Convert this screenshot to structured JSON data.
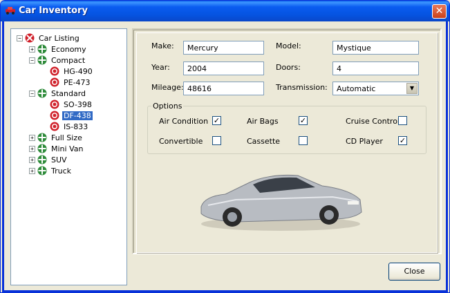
{
  "window": {
    "title": "Car Inventory",
    "close_glyph": "✕"
  },
  "tree": {
    "root": "Car Listing",
    "items": [
      {
        "label": "Economy",
        "type": "category",
        "expander": "+"
      },
      {
        "label": "Compact",
        "type": "category",
        "expander": "−"
      },
      {
        "label": "HG-490",
        "type": "car"
      },
      {
        "label": "PE-473",
        "type": "car"
      },
      {
        "label": "Standard",
        "type": "category",
        "expander": "−"
      },
      {
        "label": "SO-398",
        "type": "car"
      },
      {
        "label": "DF-438",
        "type": "car",
        "selected": true
      },
      {
        "label": "IS-833",
        "type": "car"
      },
      {
        "label": "Full Size",
        "type": "category",
        "expander": "+"
      },
      {
        "label": "Mini Van",
        "type": "category",
        "expander": "+"
      },
      {
        "label": "SUV",
        "type": "category",
        "expander": "+"
      },
      {
        "label": "Truck",
        "type": "category",
        "expander": "+"
      }
    ]
  },
  "details": {
    "make_label": "Make:",
    "make_value": "Mercury",
    "model_label": "Model:",
    "model_value": "Mystique",
    "year_label": "Year:",
    "year_value": "2004",
    "doors_label": "Doors:",
    "doors_value": "4",
    "mileage_label": "Mileage:",
    "mileage_value": "48616",
    "transmission_label": "Transmission:",
    "transmission_value": "Automatic"
  },
  "options": {
    "legend": "Options",
    "items": [
      {
        "label": "Air Condition",
        "checked": true
      },
      {
        "label": "Air Bags",
        "checked": true
      },
      {
        "label": "Cruise Control",
        "checked": false
      },
      {
        "label": "Convertible",
        "checked": false
      },
      {
        "label": "Cassette",
        "checked": false
      },
      {
        "label": "CD Player",
        "checked": true
      }
    ]
  },
  "buttons": {
    "close_label": "Close"
  },
  "colors": {
    "selection": "#316ac5",
    "titlebar": "#0553e0",
    "category_icon": "#2e8b3a",
    "car_icon": "#d0202a"
  }
}
